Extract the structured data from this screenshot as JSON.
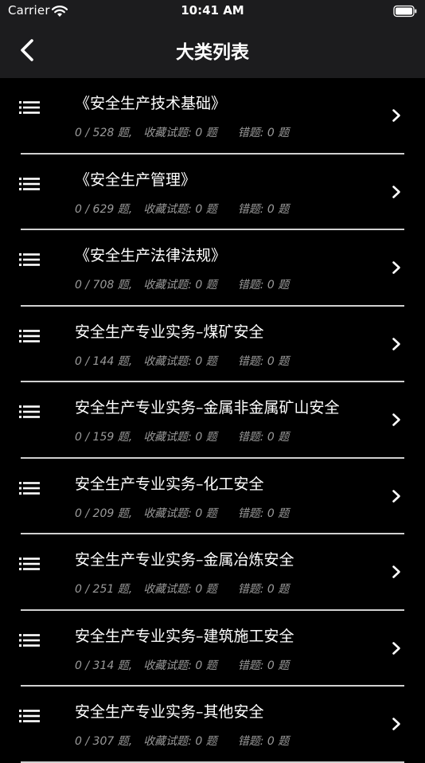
{
  "status": {
    "carrier": "Carrier",
    "time": "10:41 AM"
  },
  "nav": {
    "title": "大类列表"
  },
  "labels": {
    "separator": "/",
    "question_unit": "题,",
    "favorites_label": "收藏试题:",
    "wrong_label": "错题:",
    "unit": "题"
  },
  "items": [
    {
      "title": "《安全生产技术基础》",
      "done": "0",
      "total": "528",
      "favorites": "0",
      "wrong": "0"
    },
    {
      "title": "《安全生产管理》",
      "done": "0",
      "total": "629",
      "favorites": "0",
      "wrong": "0"
    },
    {
      "title": "《安全生产法律法规》",
      "done": "0",
      "total": "708",
      "favorites": "0",
      "wrong": "0"
    },
    {
      "title": "安全生产专业实务–煤矿安全",
      "done": "0",
      "total": "144",
      "favorites": "0",
      "wrong": "0"
    },
    {
      "title": "安全生产专业实务–金属非金属矿山安全",
      "done": "0",
      "total": "159",
      "favorites": "0",
      "wrong": "0"
    },
    {
      "title": "安全生产专业实务–化工安全",
      "done": "0",
      "total": "209",
      "favorites": "0",
      "wrong": "0"
    },
    {
      "title": "安全生产专业实务–金属冶炼安全",
      "done": "0",
      "total": "251",
      "favorites": "0",
      "wrong": "0"
    },
    {
      "title": "安全生产专业实务–建筑施工安全",
      "done": "0",
      "total": "314",
      "favorites": "0",
      "wrong": "0"
    },
    {
      "title": "安全生产专业实务–其他安全",
      "done": "0",
      "total": "307",
      "favorites": "0",
      "wrong": "0"
    }
  ],
  "icons": {
    "wifi": "wifi-icon",
    "battery": "battery-icon",
    "back": "chevron-left-icon",
    "list": "list-icon",
    "row_chevron": "chevron-right-icon"
  }
}
